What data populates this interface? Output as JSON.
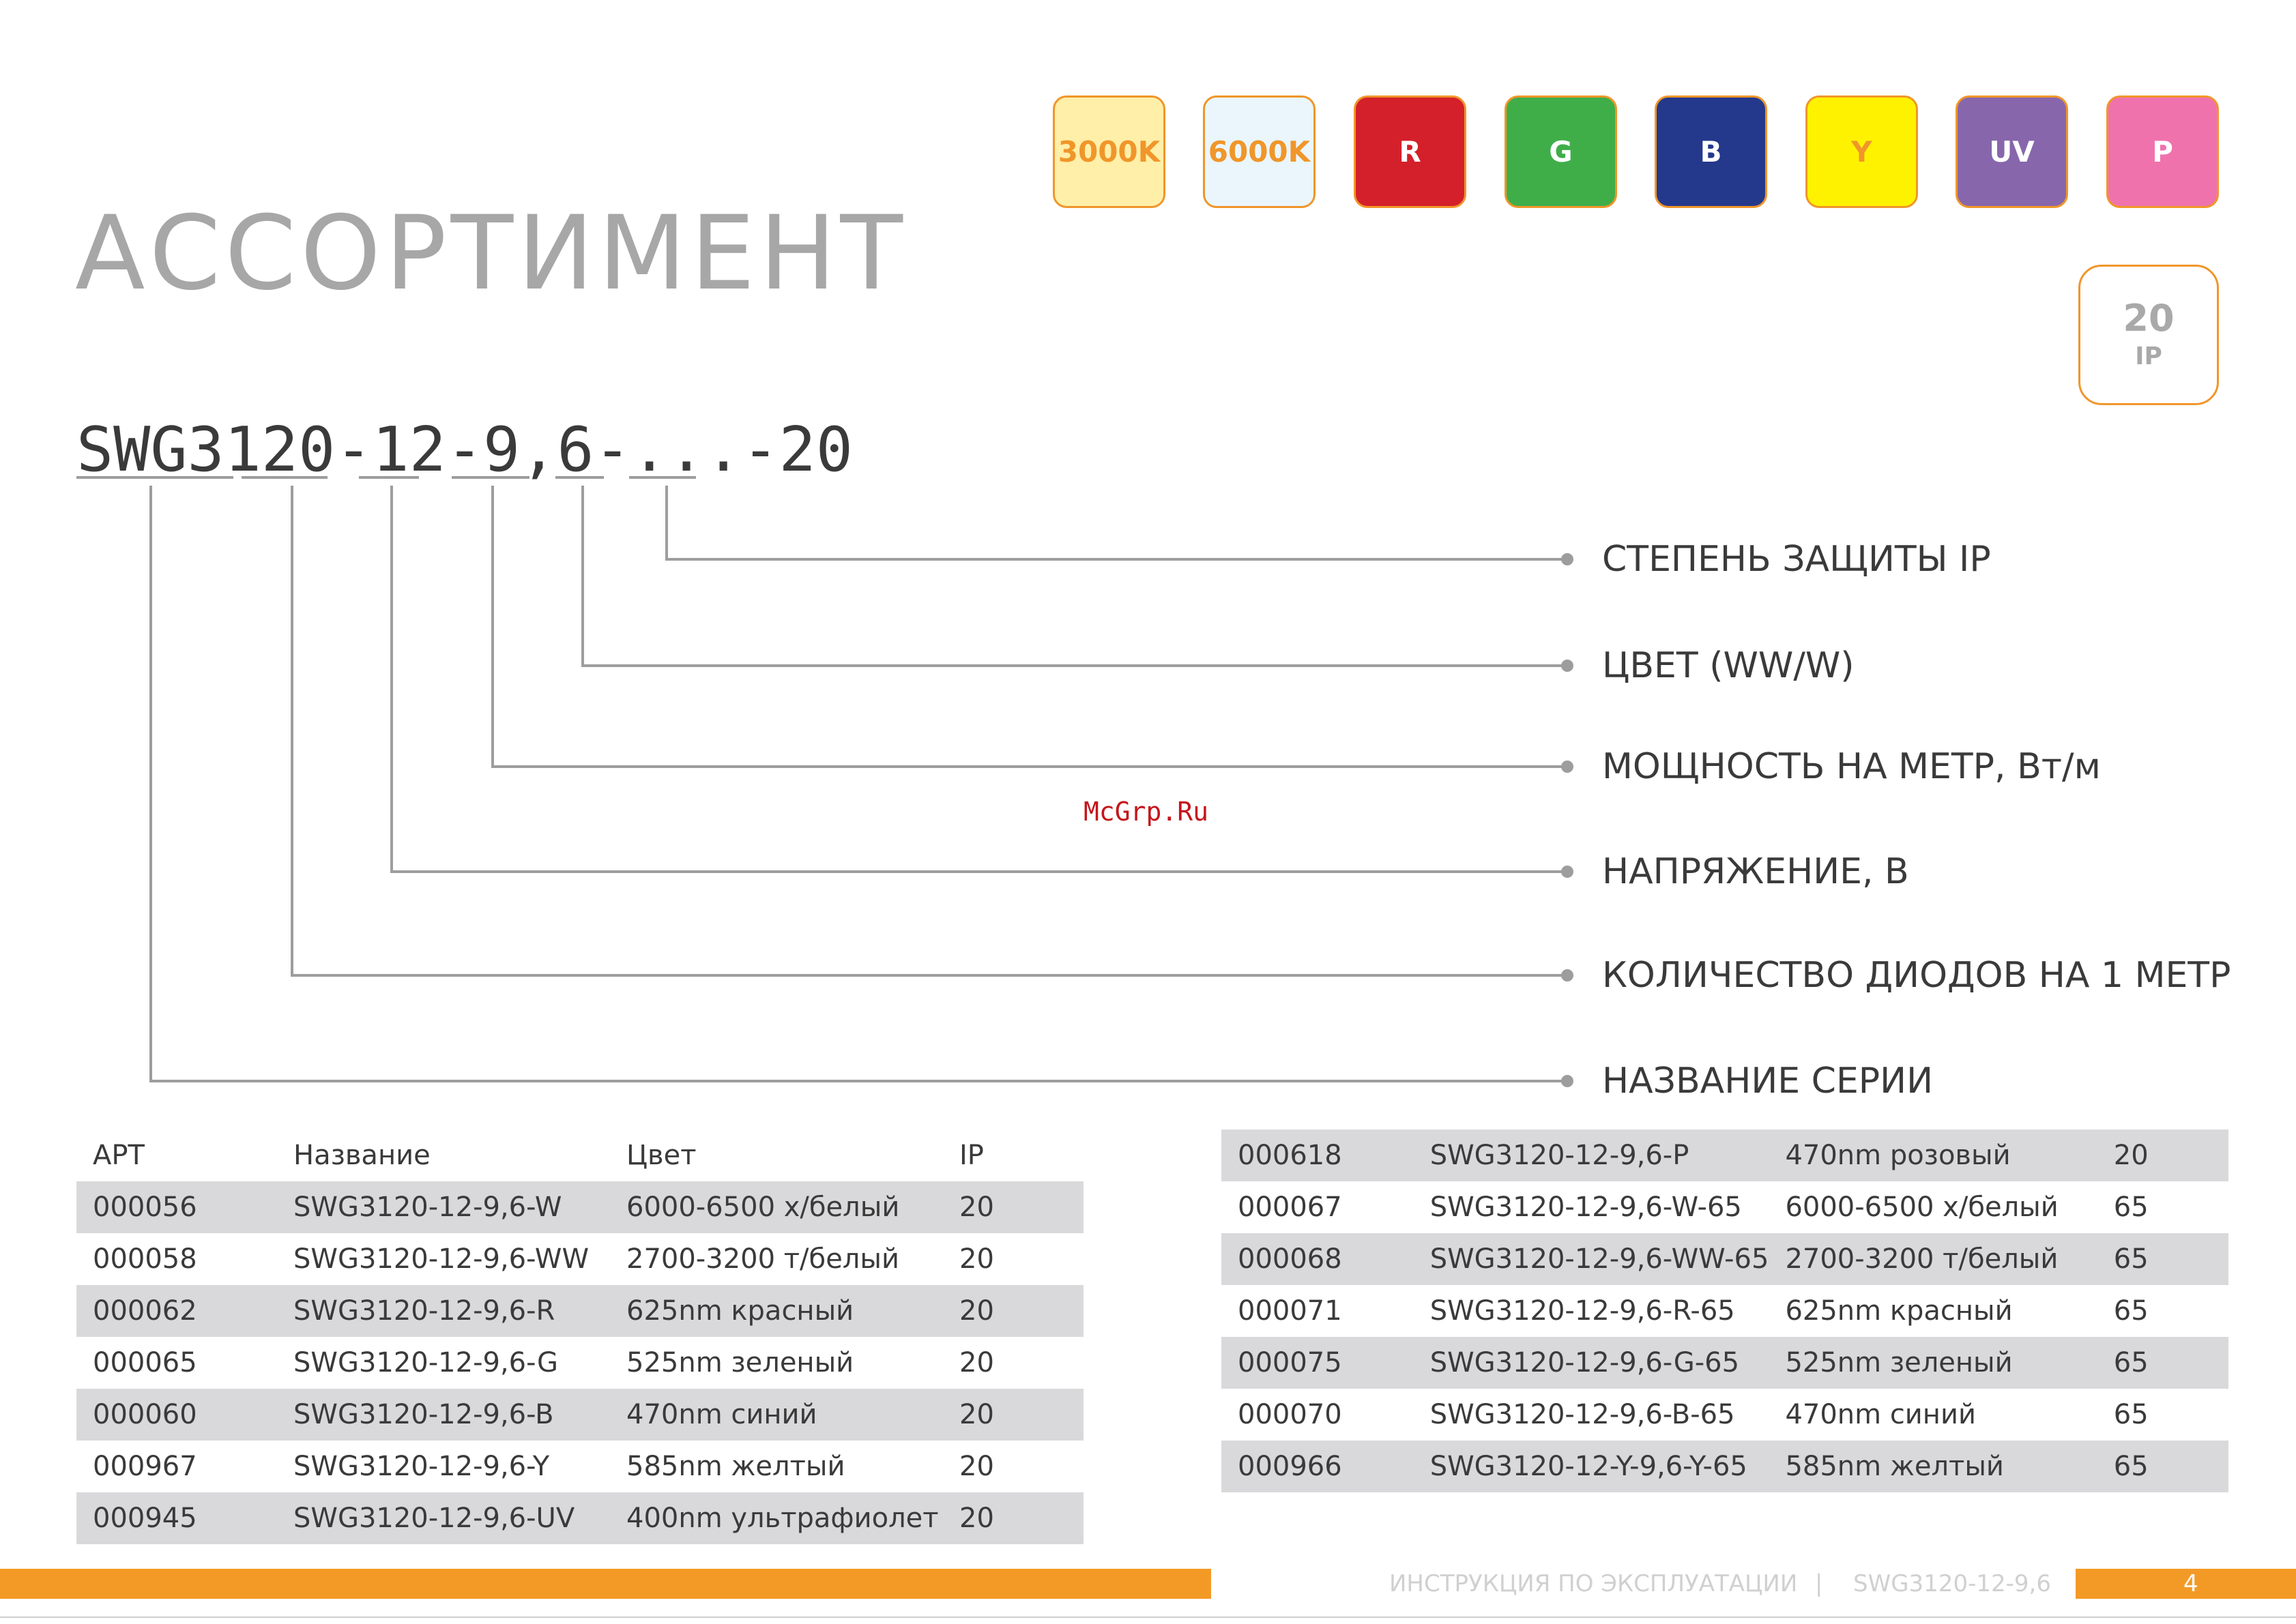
{
  "badges": [
    {
      "label": "3000K",
      "bg": "#ffefa8",
      "color": "#f0962a"
    },
    {
      "label": "6000K",
      "bg": "#eaf6fc",
      "color": "#f0962a"
    },
    {
      "label": "R",
      "bg": "#d4202a",
      "color": "#ffffff"
    },
    {
      "label": "G",
      "bg": "#3fae49",
      "color": "#ffffff"
    },
    {
      "label": "B",
      "bg": "#24398c",
      "color": "#ffffff"
    },
    {
      "label": "Y",
      "bg": "#fff200",
      "color": "#f0962a"
    },
    {
      "label": "UV",
      "bg": "#8766ac",
      "color": "#ffffff"
    },
    {
      "label": "P",
      "bg": "#ef72ad",
      "color": "#ffffff"
    }
  ],
  "ip_badge": {
    "value": "20",
    "label": "IP"
  },
  "title": "АССОРТИМЕНТ",
  "product_code": "SWG3120-12-9,6-...-20",
  "legend": [
    "СТЕПЕНЬ ЗАЩИТЫ IP",
    "ЦВЕТ (WW/W)",
    "МОЩНОСТЬ НА МЕТР, Вт/м",
    "НАПРЯЖЕНИЕ, В",
    "КОЛИЧЕСТВО ДИОДОВ НА 1 МЕТР",
    "НАЗВАНИЕ СЕРИИ"
  ],
  "watermark": "McGrp.Ru",
  "table_headers": [
    "АРТ",
    "Название",
    "Цвет",
    "IP"
  ],
  "table_left": [
    [
      "000056",
      "SWG3120-12-9,6-W",
      "6000-6500 х/белый",
      "20"
    ],
    [
      "000058",
      "SWG3120-12-9,6-WW",
      "2700-3200 т/белый",
      "20"
    ],
    [
      "000062",
      "SWG3120-12-9,6-R",
      "625nm красный",
      "20"
    ],
    [
      "000065",
      "SWG3120-12-9,6-G",
      "525nm зеленый",
      "20"
    ],
    [
      "000060",
      "SWG3120-12-9,6-B",
      "470nm   синий",
      "20"
    ],
    [
      "000967",
      "SWG3120-12-9,6-Y",
      "585nm  желтый",
      "20"
    ],
    [
      "000945",
      "SWG3120-12-9,6-UV",
      "400nm ультрафиолет",
      "20"
    ]
  ],
  "table_right": [
    [
      "000618",
      "SWG3120-12-9,6-P",
      "470nm розовый",
      "20"
    ],
    [
      "000067",
      "SWG3120-12-9,6-W-65",
      "6000-6500 х/белый",
      "65"
    ],
    [
      "000068",
      "SWG3120-12-9,6-WW-65",
      "2700-3200 т/белый",
      "65"
    ],
    [
      "000071",
      "SWG3120-12-9,6-R-65",
      "625nm красный",
      "65"
    ],
    [
      "000075",
      "SWG3120-12-9,6-G-65",
      "525nm зеленый",
      "65"
    ],
    [
      "000070",
      "SWG3120-12-9,6-B-65",
      "470nm   синий",
      "65"
    ],
    [
      "000966",
      "SWG3120-12-Y-9,6-Y-65",
      "585nm  желтый",
      "65"
    ]
  ],
  "footer": {
    "doc_title": "ИНСТРУКЦИЯ ПО ЭКСПЛУАТАЦИИ",
    "separator": "|",
    "model": "SWG3120-12-9,6",
    "page": "4"
  }
}
